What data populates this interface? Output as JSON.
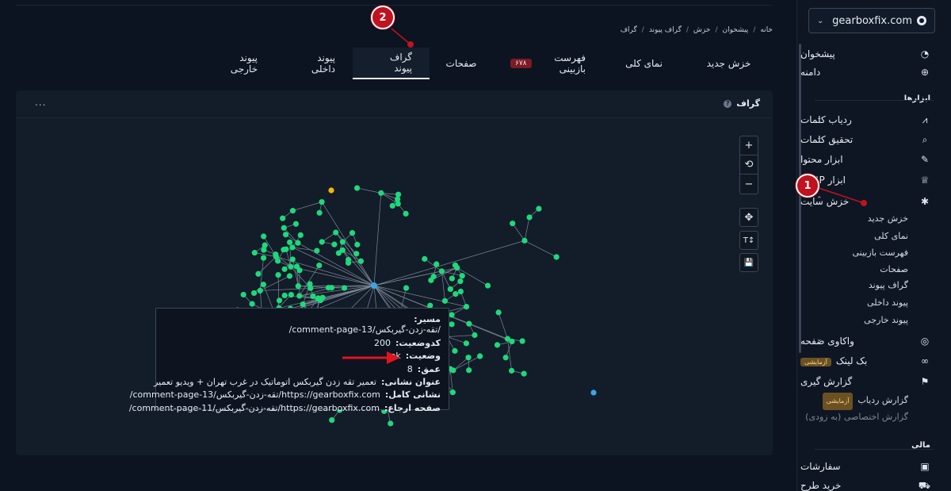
{
  "sidebar": {
    "site": "gearboxfix.com",
    "items": [
      {
        "label": "پیشخوان",
        "icon": "pie-chart-icon"
      },
      {
        "label": "دامنه",
        "icon": "globe-icon"
      }
    ],
    "tools_title": "ابزارها",
    "tools": [
      {
        "label": "ردیاب کلمات",
        "icon": "line-chart-icon"
      },
      {
        "label": "تحقیق کلمات",
        "icon": "search-icon"
      },
      {
        "label": "ابزار محتوا",
        "icon": "pen-icon"
      },
      {
        "label": "ابزار SERP",
        "icon": "trophy-icon"
      },
      {
        "label": "خزش سایت",
        "icon": "bug-icon"
      }
    ],
    "crawl_sub": [
      "خزش جدید",
      "نمای کلی",
      "فهرست بازبینی",
      "صفحات",
      "گراف پیوند",
      "پیوند داخلی",
      "پیوند خارجی"
    ],
    "more": [
      {
        "label": "واکاوی صفحه",
        "icon": "compass-icon"
      },
      {
        "label": "بک لینک",
        "icon": "link-icon",
        "badge": "آزمایشی"
      },
      {
        "label": "گزارش گیری",
        "icon": "flag-icon"
      }
    ],
    "report_sub": [
      {
        "label": "گزارش ردیاب",
        "badge": "آزمایشی"
      },
      {
        "label": "گزارش اختصاصی (به زودی)"
      }
    ],
    "finance_title": "مالی",
    "finance": [
      {
        "label": "سفارشات",
        "icon": "clipboard-icon"
      },
      {
        "label": "خرید طرح",
        "icon": "cart-icon"
      }
    ]
  },
  "breadcrumb": [
    "خانه",
    "پیشخوان",
    "خزش",
    "گراف پیوند",
    "گراف"
  ],
  "tabs": [
    {
      "label": "خزش جدید"
    },
    {
      "label": "نمای کلی"
    },
    {
      "label": "فهرست بازبینی",
      "count": "۶۷۸"
    },
    {
      "label": "صفحات"
    },
    {
      "label": "گراف پیوند",
      "active": true
    },
    {
      "label": "پیوند داخلی"
    },
    {
      "label": "پیوند خارجی"
    }
  ],
  "card": {
    "title": "گراف",
    "help": "?",
    "more": "..."
  },
  "controls": {
    "zoom_in": "+",
    "reset": "⟲",
    "zoom_out": "−",
    "fit": "✥",
    "text": "T↕",
    "save": "💾"
  },
  "tooltip": {
    "path_label": "مسیر:",
    "path_value": "/تقه-زدن-گیربکس/comment-page-13/",
    "status_label": "کدوضعیت:",
    "status_value": "200",
    "state_label": "وضعیت:",
    "state_value": "ok",
    "depth_label": "عمق:",
    "depth_value": "8",
    "title_label": "عنوان نشانی:",
    "title_value": "تعمیر تقه زدن گیربکس اتوماتیک در غرب تهران + ویدیو تعمیر",
    "url_label": "نشانی کامل:",
    "url_value": "https://gearboxfix.com/تقه-زدن-گیربکس/comment-page-13/",
    "ref_label": "صفحه ارجاع:",
    "ref_value": "https://gearboxfix.com/تقه-زدن-گیربکس/comment-page-11/"
  },
  "markers": {
    "one": "1",
    "two": "2"
  },
  "colors": {
    "node": "#1ed97a",
    "node_highlight": "#f2b705",
    "node_root": "#3aa6e6",
    "marker": "#c1121f"
  }
}
